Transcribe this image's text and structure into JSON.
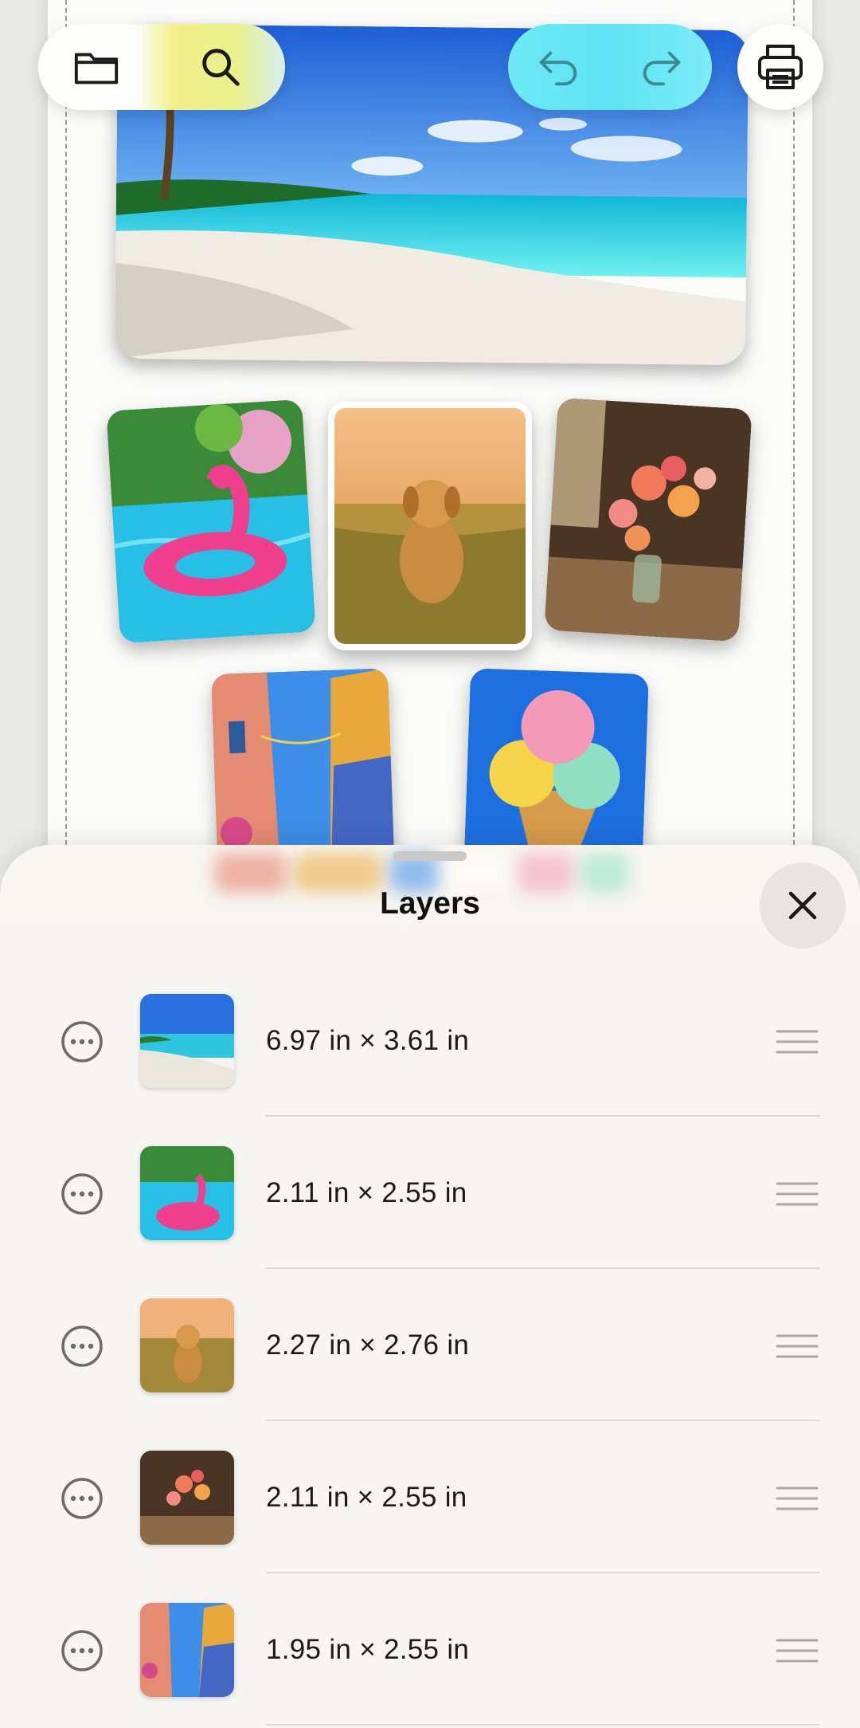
{
  "toolbar": {
    "left_icons": [
      "folder-icon",
      "search-icon"
    ],
    "history_icons": [
      "undo-icon",
      "redo-icon"
    ],
    "right_icon": "print-icon"
  },
  "canvas": {
    "photos": [
      {
        "name": "beach-photo",
        "subject": "tropical beach"
      },
      {
        "name": "flamingo-photo",
        "subject": "flamingo float in pool"
      },
      {
        "name": "dog-photo",
        "subject": "golden retriever in field"
      },
      {
        "name": "flowers-photo",
        "subject": "flower bouquet in vase"
      },
      {
        "name": "street-photo",
        "subject": "colorful street"
      },
      {
        "name": "icecream-photo",
        "subject": "ice cream cone"
      }
    ]
  },
  "sheet": {
    "title": "Layers",
    "close_icon": "close-icon"
  },
  "layers": [
    {
      "size": "6.97 in × 3.61 in",
      "thumb": "beach"
    },
    {
      "size": "2.11 in × 2.55 in",
      "thumb": "flamingo"
    },
    {
      "size": "2.27 in × 2.76 in",
      "thumb": "dog"
    },
    {
      "size": "2.11 in × 2.55 in",
      "thumb": "flowers"
    },
    {
      "size": "1.95 in × 2.55 in",
      "thumb": "street"
    }
  ],
  "colors": {
    "accent_cyan": "#5ee2f4",
    "sheet_background": "#f6f5f2",
    "icon_stroke": "#1a1a1a",
    "muted_icon": "#6b6b6b"
  }
}
